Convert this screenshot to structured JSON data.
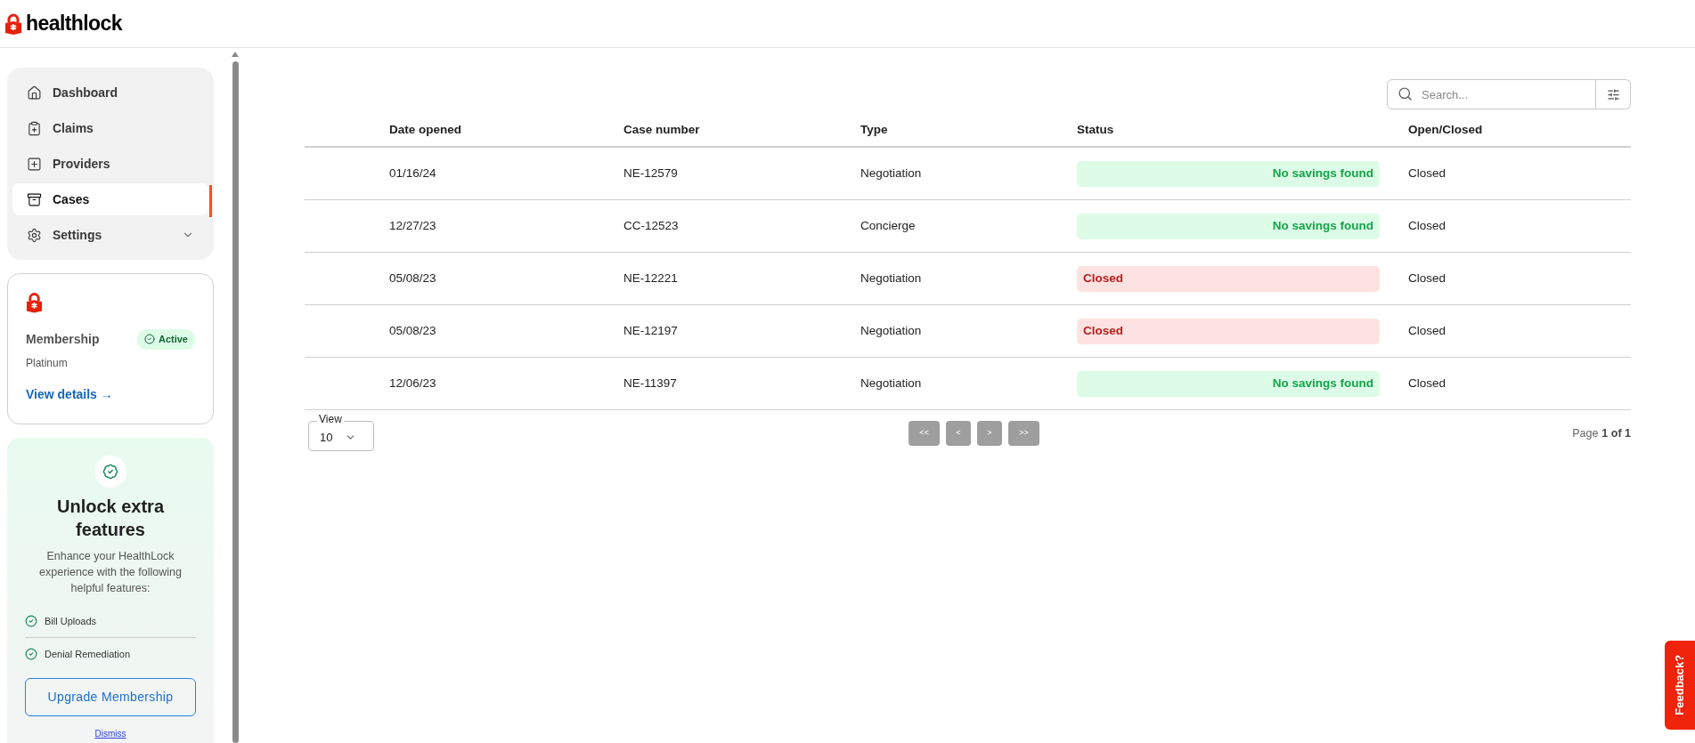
{
  "brand": {
    "name": "healthlock"
  },
  "sidebar": {
    "items": [
      {
        "label": "Dashboard",
        "selected": false
      },
      {
        "label": "Claims",
        "selected": false
      },
      {
        "label": "Providers",
        "selected": false
      },
      {
        "label": "Cases",
        "selected": true
      },
      {
        "label": "Settings",
        "selected": false,
        "expanded": false
      }
    ]
  },
  "membership": {
    "title": "Membership",
    "badge": "Active",
    "plan": "Platinum",
    "link": "View details →"
  },
  "upsell": {
    "title": "Unlock extra features",
    "description": "Enhance your HealthLock experience with the following helpful features:",
    "features": [
      "Bill Uploads",
      "Denial Remediation"
    ],
    "button": "Upgrade Membership",
    "dismiss": "Dismiss"
  },
  "search": {
    "placeholder": "Search..."
  },
  "table": {
    "columns": [
      "Date opened",
      "Case number",
      "Type",
      "Status",
      "Open/Closed"
    ],
    "rows": [
      {
        "date": "01/16/24",
        "case": "NE-12579",
        "type": "Negotiation",
        "status": {
          "label": "No savings found",
          "kind": "success"
        },
        "open_closed": "Closed"
      },
      {
        "date": "12/27/23",
        "case": "CC-12523",
        "type": "Concierge",
        "status": {
          "label": "No savings found",
          "kind": "success"
        },
        "open_closed": "Closed"
      },
      {
        "date": "05/08/23",
        "case": "NE-12221",
        "type": "Negotiation",
        "status": {
          "label": "Closed",
          "kind": "danger"
        },
        "open_closed": "Closed"
      },
      {
        "date": "05/08/23",
        "case": "NE-12197",
        "type": "Negotiation",
        "status": {
          "label": "Closed",
          "kind": "danger"
        },
        "open_closed": "Closed"
      },
      {
        "date": "12/06/23",
        "case": "NE-11397",
        "type": "Negotiation",
        "status": {
          "label": "No savings found",
          "kind": "success"
        },
        "open_closed": "Closed"
      }
    ]
  },
  "pagination": {
    "view_label": "View",
    "view_value": "10",
    "buttons": [
      "<<",
      "<",
      ">",
      ">>"
    ],
    "page_prefix": "Page",
    "page_value": "1 of 1"
  },
  "feedback": "Feedback?"
}
